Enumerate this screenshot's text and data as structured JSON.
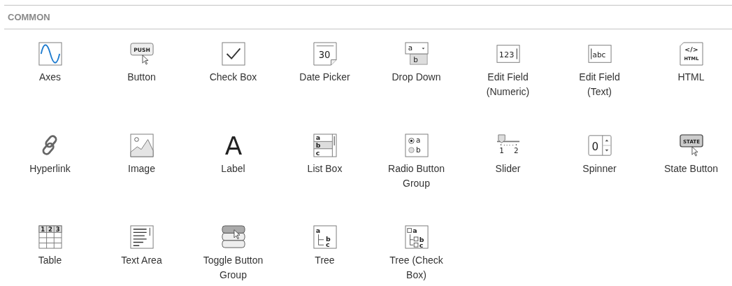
{
  "section": {
    "title": "COMMON"
  },
  "components": [
    {
      "label": "Axes",
      "kind": "axes"
    },
    {
      "label": "Button",
      "kind": "button",
      "icon_text": [
        "PUSH"
      ]
    },
    {
      "label": "Check Box",
      "kind": "checkbox"
    },
    {
      "label": "Date Picker",
      "kind": "datepicker",
      "icon_text": [
        "30"
      ]
    },
    {
      "label": "Drop Down",
      "kind": "dropdown",
      "icon_text": [
        "a",
        "b"
      ]
    },
    {
      "label": "Edit Field (Numeric)",
      "kind": "numeric",
      "icon_text": [
        "123"
      ]
    },
    {
      "label": "Edit Field (Text)",
      "kind": "textfield",
      "icon_text": [
        "abc"
      ]
    },
    {
      "label": "HTML",
      "kind": "html",
      "icon_text": [
        "</>",
        "HTML"
      ]
    },
    {
      "label": "Hyperlink",
      "kind": "hyperlink"
    },
    {
      "label": "Image",
      "kind": "image"
    },
    {
      "label": "Label",
      "kind": "label",
      "icon_text": [
        "A"
      ]
    },
    {
      "label": "List Box",
      "kind": "listbox",
      "icon_text": [
        "a",
        "b",
        "c"
      ]
    },
    {
      "label": "Radio Button Group",
      "kind": "radio",
      "icon_text": [
        "a",
        "b"
      ]
    },
    {
      "label": "Slider",
      "kind": "slider",
      "icon_text": [
        "1",
        "2"
      ]
    },
    {
      "label": "Spinner",
      "kind": "spinner",
      "icon_text": [
        "0"
      ]
    },
    {
      "label": "State Button",
      "kind": "state",
      "icon_text": [
        "STATE"
      ]
    },
    {
      "label": "Table",
      "kind": "table",
      "icon_text": [
        "1",
        "2",
        "3"
      ]
    },
    {
      "label": "Text Area",
      "kind": "textarea"
    },
    {
      "label": "Toggle Button Group",
      "kind": "togglegroup"
    },
    {
      "label": "Tree",
      "kind": "tree",
      "icon_text": [
        "a",
        "b",
        "c"
      ]
    },
    {
      "label": "Tree (Check Box)",
      "kind": "treecheck",
      "icon_text": [
        "a",
        "b",
        "c"
      ]
    }
  ]
}
